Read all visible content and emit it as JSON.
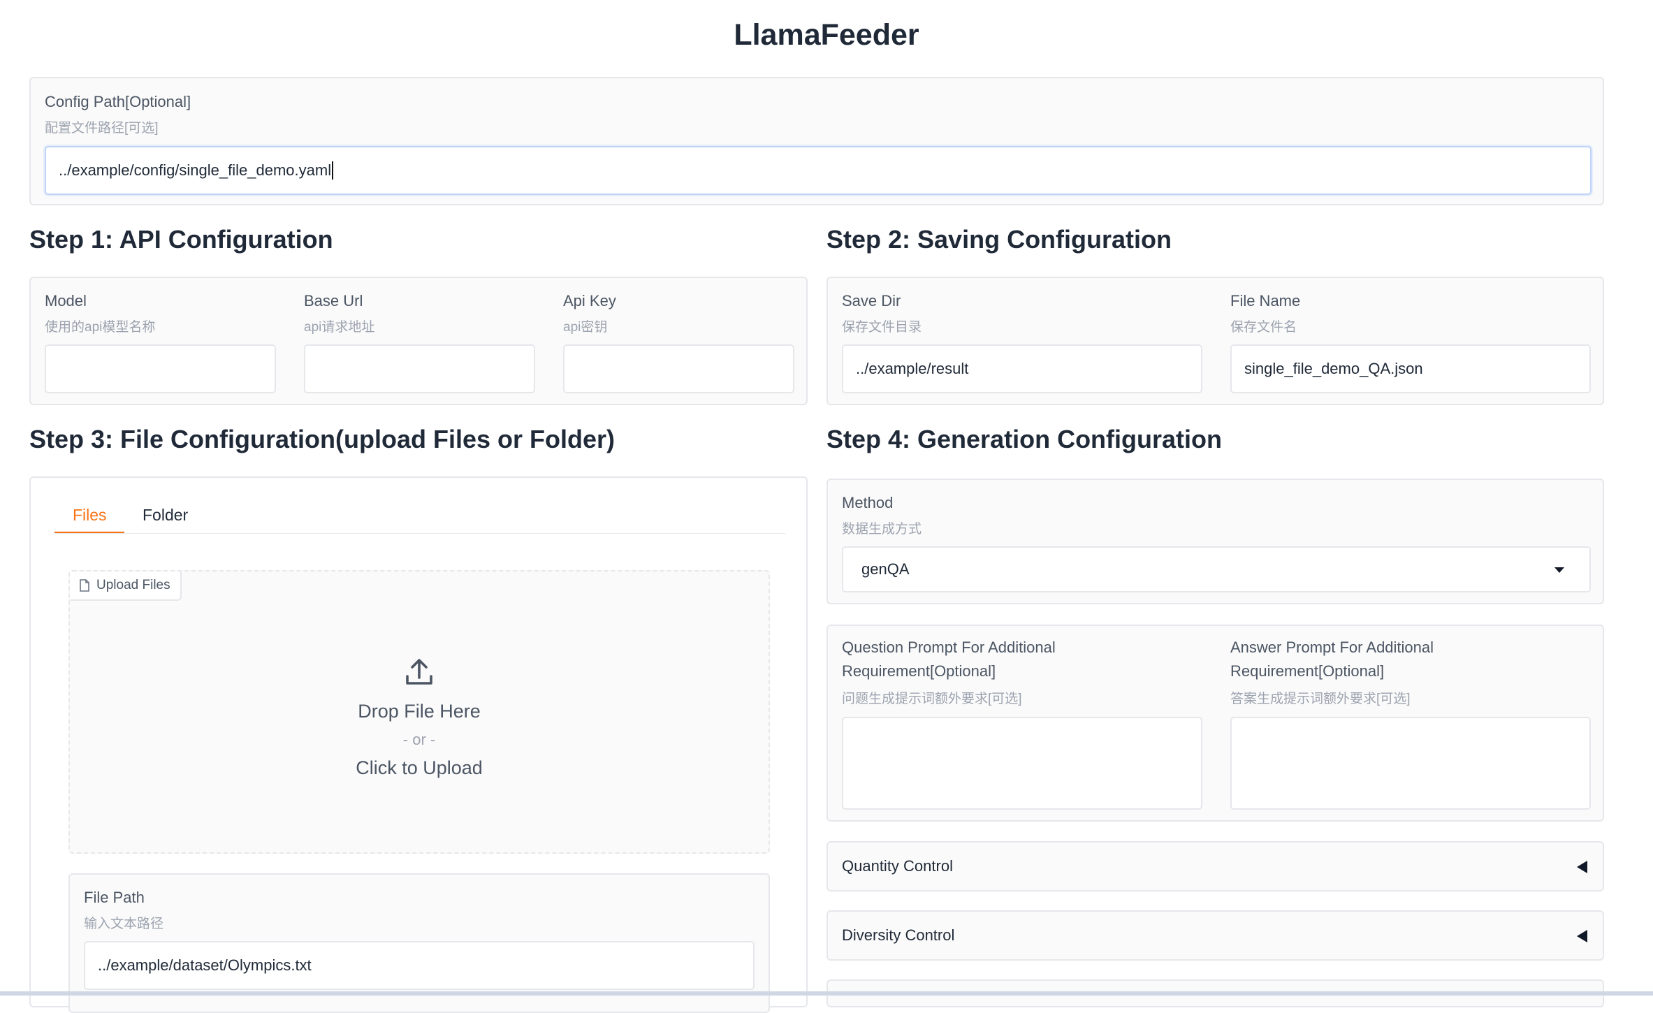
{
  "app": {
    "title": "LlamaFeeder"
  },
  "config": {
    "label": "Config Path[Optional]",
    "sublabel": "配置文件路径[可选]",
    "value": "../example/config/single_file_demo.yaml"
  },
  "step1": {
    "heading": "Step 1: API Configuration",
    "model": {
      "label": "Model",
      "sublabel": "使用的api模型名称",
      "value": ""
    },
    "base_url": {
      "label": "Base Url",
      "sublabel": "api请求地址",
      "value": ""
    },
    "api_key": {
      "label": "Api Key",
      "sublabel": "api密钥",
      "value": ""
    }
  },
  "step2": {
    "heading": "Step 2: Saving Configuration",
    "save_dir": {
      "label": "Save Dir",
      "sublabel": "保存文件目录",
      "value": "../example/result"
    },
    "file_name": {
      "label": "File Name",
      "sublabel": "保存文件名",
      "value": "single_file_demo_QA.json"
    }
  },
  "step3": {
    "heading": "Step 3: File Configuration(upload Files or Folder)",
    "tabs": [
      "Files",
      "Folder"
    ],
    "active_tab": "Files",
    "upload_badge": "Upload Files",
    "drop_text": "Drop File Here",
    "or_text": "- or -",
    "click_text": "Click to Upload",
    "file_path": {
      "label": "File Path",
      "sublabel": "输入文本路径",
      "value": "../example/dataset/Olympics.txt"
    }
  },
  "step4": {
    "heading": "Step 4: Generation Configuration",
    "method": {
      "label": "Method",
      "sublabel": "数据生成方式",
      "value": "genQA"
    },
    "question_prompt": {
      "label_line1": "Question Prompt For Additional",
      "label_line2": "Requirement[Optional]",
      "sublabel": "问题生成提示词额外要求[可选]",
      "value": ""
    },
    "answer_prompt": {
      "label_line1": "Answer Prompt For Additional",
      "label_line2": "Requirement[Optional]",
      "sublabel": "答案生成提示词额外要求[可选]",
      "value": ""
    },
    "accordions": [
      "Quantity Control",
      "Diversity Control"
    ]
  },
  "colors": {
    "accent": "#f97316",
    "border": "#e5e7eb",
    "panel_bg": "#fafafa",
    "focus": "#bfd3f7"
  },
  "icons": {
    "upload": "upload-icon",
    "file": "file-icon",
    "dropdown": "chevron-down-icon",
    "accordion": "triangle-left-icon"
  }
}
